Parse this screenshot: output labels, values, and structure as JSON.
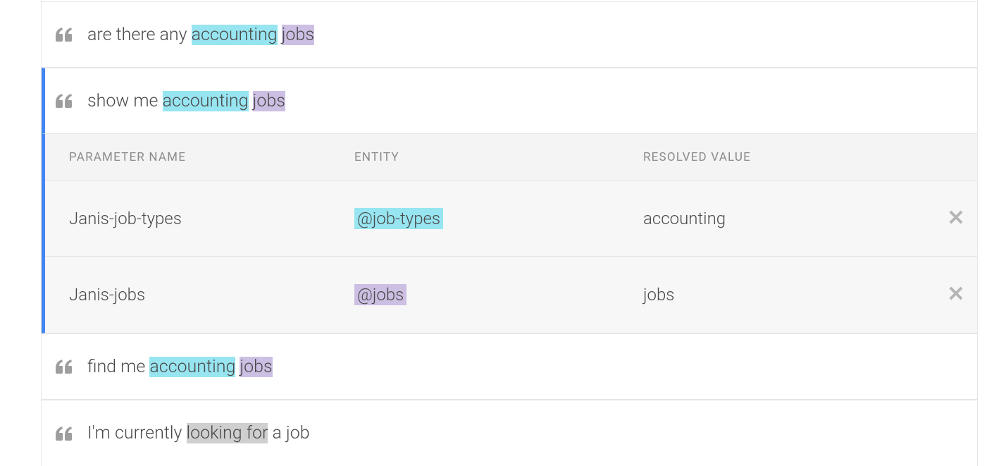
{
  "phrases": [
    {
      "segments": [
        {
          "text": "are there any ",
          "hl": ""
        },
        {
          "text": "accounting",
          "hl": "cyan"
        },
        {
          "text": " ",
          "hl": ""
        },
        {
          "text": "jobs",
          "hl": "purple"
        }
      ],
      "selected": false
    },
    {
      "segments": [
        {
          "text": "show me ",
          "hl": ""
        },
        {
          "text": "accounting",
          "hl": "cyan"
        },
        {
          "text": " ",
          "hl": ""
        },
        {
          "text": "jobs",
          "hl": "purple"
        }
      ],
      "selected": true
    },
    {
      "segments": [
        {
          "text": "find me ",
          "hl": ""
        },
        {
          "text": "accounting",
          "hl": "cyan"
        },
        {
          "text": " ",
          "hl": ""
        },
        {
          "text": "jobs",
          "hl": "purple"
        }
      ],
      "selected": false
    },
    {
      "segments": [
        {
          "text": "I'm currently ",
          "hl": ""
        },
        {
          "text": "looking for",
          "hl": "gray"
        },
        {
          "text": " a job",
          "hl": ""
        }
      ],
      "selected": false
    }
  ],
  "paramsHeader": {
    "name": "PARAMETER NAME",
    "entity": "ENTITY",
    "value": "RESOLVED VALUE"
  },
  "params": [
    {
      "name": "Janis-job-types",
      "entity": "@job-types",
      "entityHl": "cyan",
      "value": "accounting"
    },
    {
      "name": "Janis-jobs",
      "entity": "@jobs",
      "entityHl": "purple",
      "value": "jobs"
    }
  ]
}
